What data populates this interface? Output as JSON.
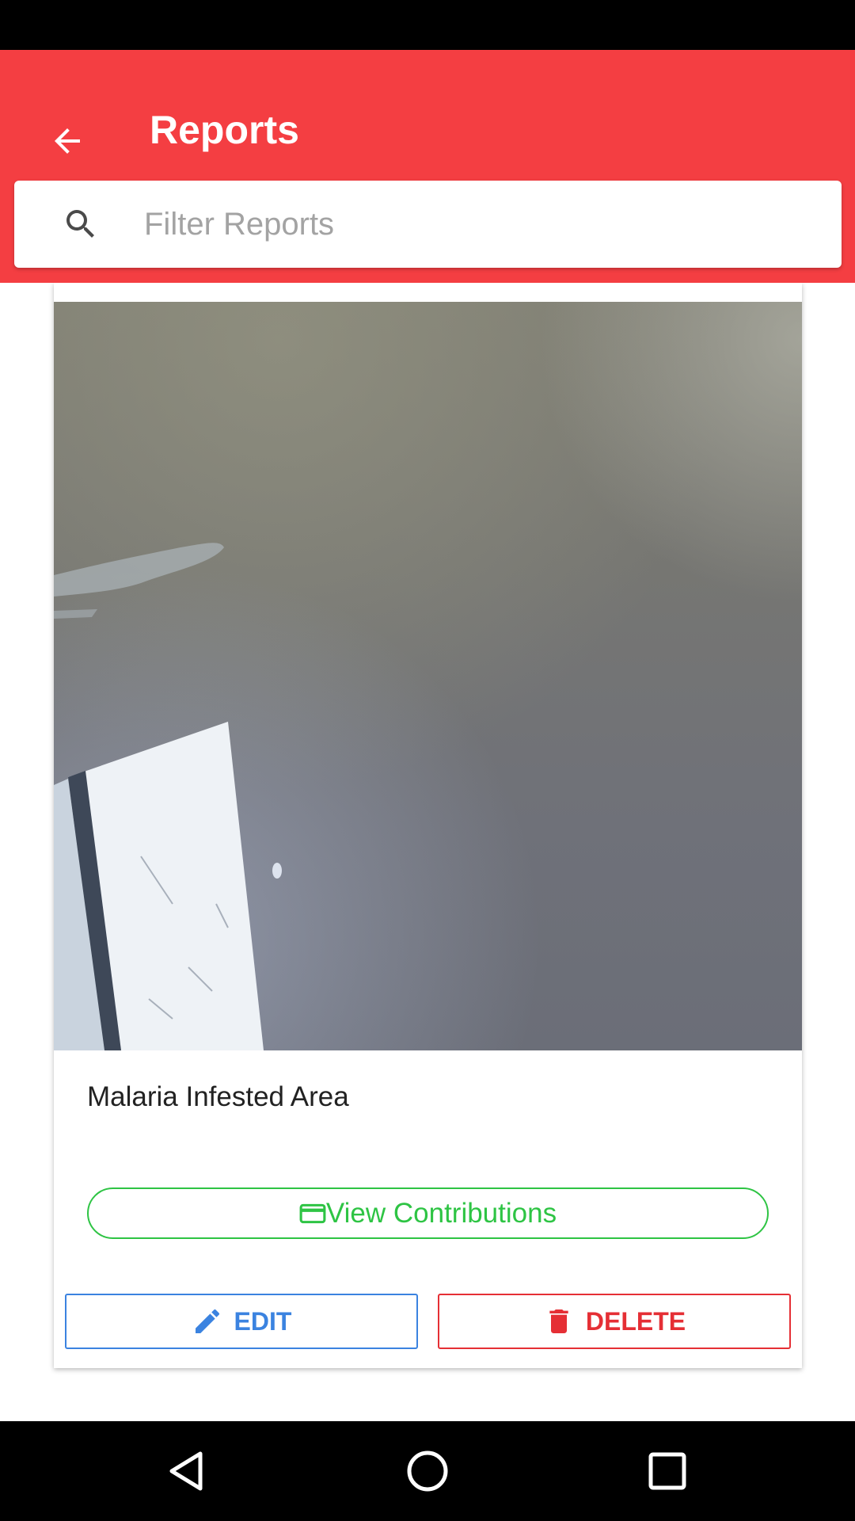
{
  "app_bar": {
    "title": "Reports",
    "back_icon": "arrow-back-icon",
    "background_color": "#f43e42"
  },
  "search": {
    "icon": "search-icon",
    "placeholder": "Filter Reports",
    "value": ""
  },
  "report_card": {
    "photo": "report-photo",
    "title": "Malaria Infested Area",
    "view_contributions": {
      "label": "View Contributions",
      "icon": "card-icon",
      "color": "#2ec444"
    },
    "edit": {
      "label": "EDIT",
      "icon": "pencil-icon",
      "color": "#3b83e0"
    },
    "delete": {
      "label": "DELETE",
      "icon": "trash-icon",
      "color": "#e52f35"
    }
  },
  "nav_bar": {
    "back": "nav-back-icon",
    "home": "nav-home-icon",
    "recents": "nav-recents-icon"
  }
}
